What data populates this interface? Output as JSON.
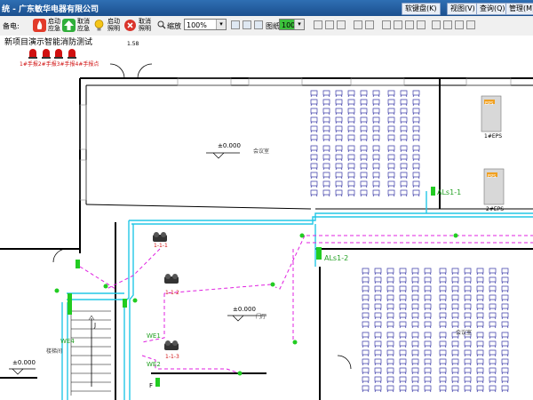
{
  "window": {
    "title": "统 - 广东敏华电器有限公司",
    "menu": [
      "软键盘(K)",
      "视图(V)",
      "查询(Q)",
      "管理(M)"
    ]
  },
  "toolbar": {
    "left_label": "备电:",
    "start_emergency": "启动应急",
    "cancel_emergency": "取消应急",
    "start_lighting": "启动照明",
    "cancel_lighting": "取消照明",
    "zoom_label": "缩放",
    "zoom_value": "100%",
    "layer_label": "图纸",
    "layer_value": "100%"
  },
  "project": {
    "name": "新项目演示智能消防测试",
    "legend": "1#手报2#手报3#手报4#手报点"
  },
  "plan": {
    "elevation_1": "±0.000",
    "elevation_2": "±0.000",
    "elevation_3": "±0.000",
    "room_1": "会议室",
    "room_2": "门厅",
    "room_3": "会议室",
    "stair": "楼梯间",
    "eps_1": "EPS",
    "eps_1_id": "1#EPS",
    "eps_2": "EPS",
    "eps_2_id": "2#EPS",
    "circuit_1": "ALs1-1",
    "circuit_2": "ALs1-2",
    "fixture_1": "1-1-1",
    "fixture_2": "1-1-2",
    "fixture_3": "1-1-3",
    "we_1": "WE4",
    "we_2": "WE1",
    "we_3": "WE2",
    "mark_j": "J",
    "mark_f": "F",
    "dim": "1.58"
  },
  "colors": {
    "titlebar": "#2f6fb3",
    "wall": "#000000",
    "wire_cyan": "#23c7e6",
    "wire_magenta": "#e020e0",
    "device_green": "#22cc22",
    "alarm_red": "#d01010",
    "chair_blue": "#3b3ba8"
  }
}
